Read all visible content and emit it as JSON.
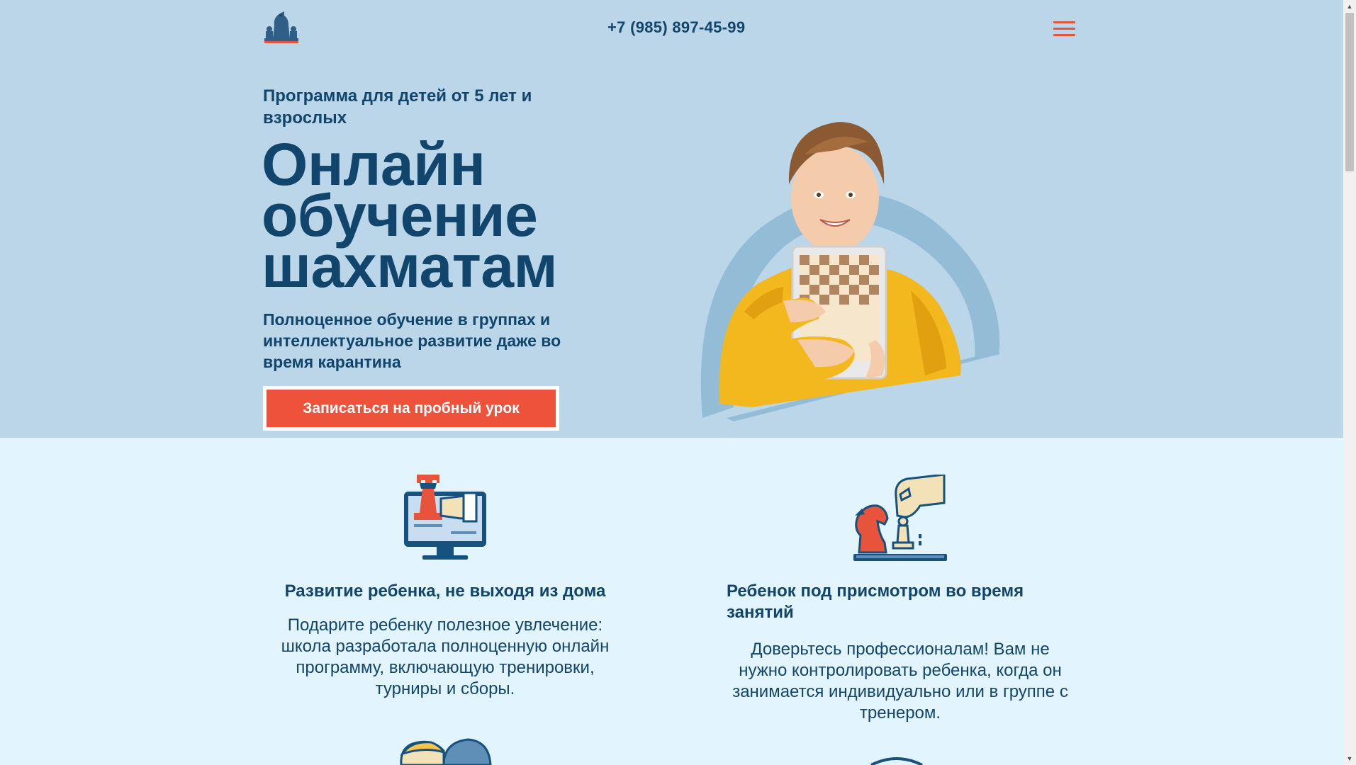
{
  "header": {
    "phone": "+7 (985) 897-45-99",
    "logo_icon": "chess-knight-logo-icon",
    "menu_icon": "hamburger-menu-icon"
  },
  "hero": {
    "subtitle": "Программа для детей от 5 лет и взрослых",
    "title_line1": "Онлайн",
    "title_line2": "обучение",
    "title_line3": "шахматам",
    "lead": "Полноценное обучение в группах и интеллектуальное развитие даже во время карантина",
    "cta_label": "Записаться на пробный урок",
    "image": "boy-holding-chess-tablet"
  },
  "features": [
    {
      "icon": "computer-chess-rook-icon",
      "title": "Развитие ребенка, не выходя из дома",
      "text": "Подарите ребенку полезное увлечение: школа разработала полноценную онлайн программу, включающую тренировки, турниры и сборы."
    },
    {
      "icon": "hand-moving-chess-piece-icon",
      "title": "Ребенок под присмотром во время занятий",
      "text": "Доверьтесь профессионалам! Вам не нужно контролировать ребенка, когда он занимается индивидуально или в группе с тренером."
    }
  ],
  "colors": {
    "hero_bg": "#bad6e8",
    "page_bg": "#e2f4fd",
    "text": "#11456c",
    "accent": "#ee523b"
  }
}
